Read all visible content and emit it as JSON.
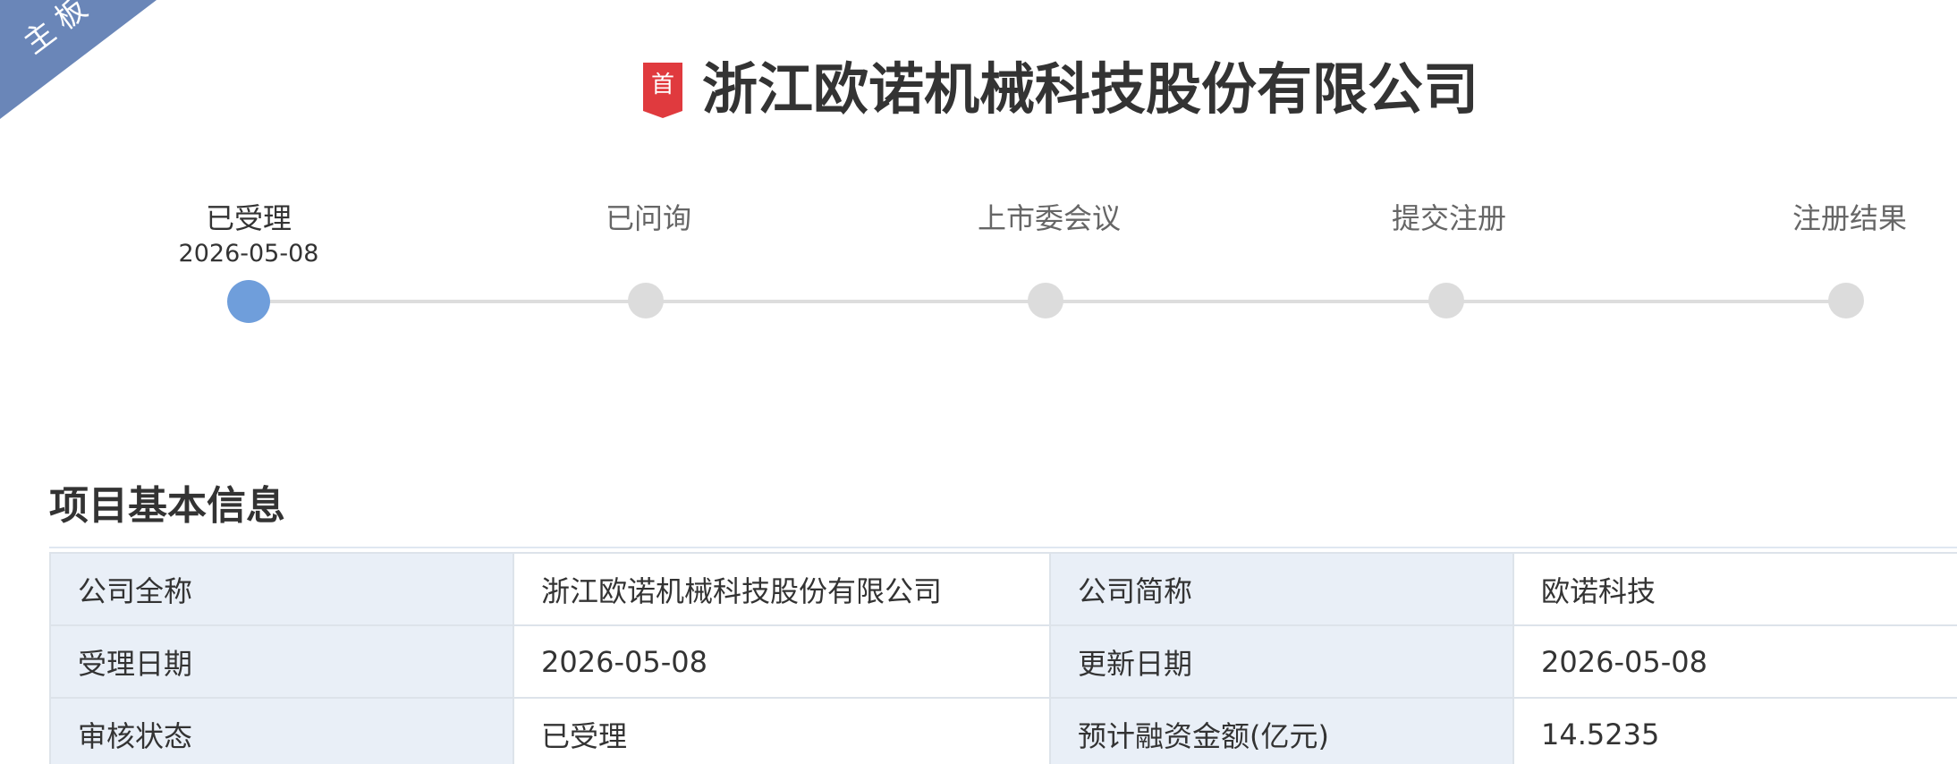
{
  "board_tag": "主板",
  "first_badge": "首",
  "company_title": "浙江欧诺机械科技股份有限公司",
  "timeline": {
    "steps": [
      {
        "label": "已受理",
        "date": "2026-05-08",
        "active": true
      },
      {
        "label": "已问询",
        "date": "",
        "active": false
      },
      {
        "label": "上市委会议",
        "date": "",
        "active": false
      },
      {
        "label": "提交注册",
        "date": "",
        "active": false
      },
      {
        "label": "注册结果",
        "date": "",
        "active": false
      }
    ]
  },
  "section": {
    "title": "项目基本信息"
  },
  "info_table": {
    "rows": [
      {
        "label1": "公司全称",
        "value1": "浙江欧诺机械科技股份有限公司",
        "label2": "公司简称",
        "value2": "欧诺科技"
      },
      {
        "label1": "受理日期",
        "value1": "2026-05-08",
        "label2": "更新日期",
        "value2": "2026-05-08"
      },
      {
        "label1": "审核状态",
        "value1": "已受理",
        "label2": "预计融资金额(亿元)",
        "value2": "14.5235"
      }
    ]
  },
  "colors": {
    "ribbon": "#6a86b8",
    "badge_red": "#e03a3e",
    "active_dot": "#6f9edb",
    "inactive_dot": "#dcdcdc",
    "label_cell_bg": "#e9eff7"
  }
}
